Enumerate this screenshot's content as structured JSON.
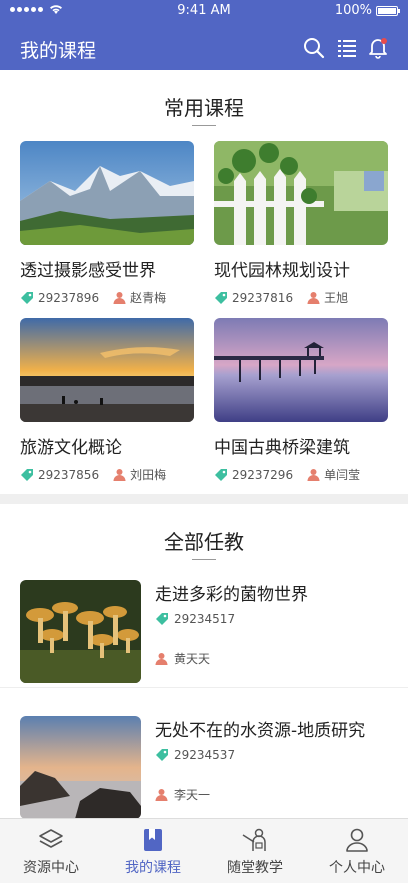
{
  "status_bar": {
    "time": "9:41 AM",
    "battery": "100%"
  },
  "header": {
    "title": "我的课程",
    "icons": [
      "search-icon",
      "list-icon",
      "bell-icon"
    ],
    "color": "#5166c4"
  },
  "common_courses": {
    "title": "常用课程",
    "items": [
      {
        "title": "透过摄影感受世界",
        "id": "29237896",
        "teacher": "赵青梅",
        "image": "snowy-mountains"
      },
      {
        "title": "现代园林规划设计",
        "id": "29237816",
        "teacher": "王旭",
        "image": "garden-fence"
      },
      {
        "title": "旅游文化概论",
        "id": "29237856",
        "teacher": "刘田梅",
        "image": "sunset-beach"
      },
      {
        "title": "中国古典桥梁建筑",
        "id": "29237296",
        "teacher": "单闫莹",
        "image": "pier-pavilion"
      }
    ]
  },
  "all_tasks": {
    "title": "全部任教",
    "items": [
      {
        "title": "走进多彩的菌物世界",
        "id": "29234517",
        "teacher": "黄天天",
        "image": "mushrooms"
      },
      {
        "title": "无处不在的水资源-地质研究",
        "id": "29234537",
        "teacher": "李天一",
        "image": "rocky-coast"
      }
    ]
  },
  "tabbar": {
    "tabs": [
      {
        "label": "资源中心",
        "icon": "layers-icon",
        "active": false
      },
      {
        "label": "我的课程",
        "icon": "bookmark-book-icon",
        "active": true
      },
      {
        "label": "随堂教学",
        "icon": "teacher-board-icon",
        "active": false
      },
      {
        "label": "个人中心",
        "icon": "user-icon",
        "active": false
      }
    ]
  },
  "colors": {
    "tag": "#3dbfa0",
    "person": "#e57f6d",
    "accent": "#5166c4"
  }
}
